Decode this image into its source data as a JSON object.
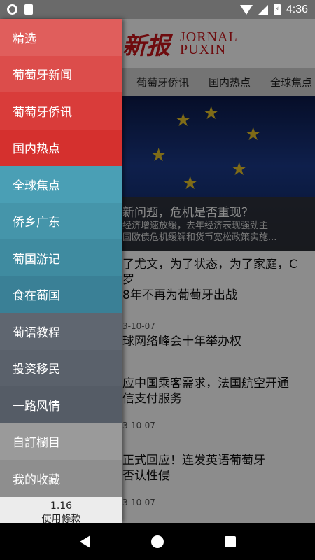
{
  "status_bar": {
    "time": "4:36",
    "battery_glyph": "⚡"
  },
  "app": {
    "brand_cn": "新报",
    "brand_en_line1": "JORNAL",
    "brand_en_line2": "PUXIN",
    "tabs": [
      "葡萄牙侨讯",
      "国内热点",
      "全球焦点"
    ],
    "hero": {
      "title": "新问题，危机是否重现？",
      "sub1": "经济增速放缓，去年经济表现强劲主",
      "sub2": "国欧债危机缓解和货币宽松政策实施..."
    },
    "news": [
      {
        "title": "了尤文，为了状态，为了家庭，C罗",
        "title2": "8年不再为葡萄牙出战",
        "date": "3-10-07"
      },
      {
        "title": "球网络峰会十年举办权",
        "title2": "",
        "date": ""
      },
      {
        "title": "应中国乘客需求，法国航空开通",
        "title2": "信支付服务",
        "date": "3-10-07"
      },
      {
        "title": "正式回应！连发英语葡萄牙",
        "title2": "否认性侵",
        "date": "3-10-07"
      }
    ]
  },
  "drawer": {
    "items": [
      {
        "label": "精选",
        "color": "#e05e5c"
      },
      {
        "label": "葡萄牙新闻",
        "color": "#dc4d4b"
      },
      {
        "label": "葡萄牙侨讯",
        "color": "#d93c3a"
      },
      {
        "label": "国内热点",
        "color": "#d5302e"
      },
      {
        "label": "全球焦点",
        "color": "#4a9fb5"
      },
      {
        "label": "侨乡广东",
        "color": "#4595aa"
      },
      {
        "label": "葡国游记",
        "color": "#3f8ba0"
      },
      {
        "label": "食在葡国",
        "color": "#3a8096"
      },
      {
        "label": "葡语教程",
        "color": "#5f6670"
      },
      {
        "label": "投资移民",
        "color": "#5a616b"
      },
      {
        "label": "一路风情",
        "color": "#555c66"
      },
      {
        "label": "自訂欄目",
        "color": "#9a9a9a"
      },
      {
        "label": "我的收藏",
        "color": "#8e8e8e"
      }
    ],
    "version": "1.16",
    "terms": "使用條款"
  }
}
